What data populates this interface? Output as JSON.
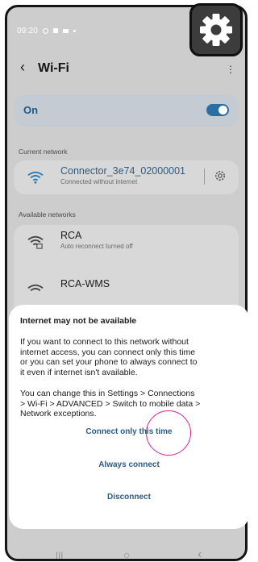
{
  "status_bar": {
    "time": "09:20",
    "icons": [
      "whatsapp-icon",
      "gallery-icon",
      "folder-icon",
      "dot-icon"
    ]
  },
  "header": {
    "title": "Wi-Fi",
    "back_icon": "back-chevron-icon",
    "more_icon": "more-vert-icon"
  },
  "wifi_toggle": {
    "label": "On",
    "state": "on",
    "accent": "#2a6fa3"
  },
  "current": {
    "section_label": "Current network",
    "name": "Connector_3e74_02000001",
    "status": "Connected without internet",
    "name_color": "#2d5b82"
  },
  "available": {
    "section_label": "Available networks",
    "networks": [
      {
        "name": "RCA",
        "status": "Auto reconnect turned off"
      },
      {
        "name": "RCA-WMS",
        "status": ""
      }
    ]
  },
  "dialog": {
    "title": "Internet may not be available",
    "body_1": [
      "If you want to connect to this network without",
      "internet access, you can connect only this time",
      "or you can set your phone to always connect to",
      "it even if internet isn't available."
    ],
    "body_2": [
      "You can change this in Settings > Connections",
      "> Wi-Fi > ADVANCED > Switch to mobile data >",
      "Network exceptions."
    ],
    "buttons": {
      "connect_once": "Connect only this time",
      "always": "Always connect",
      "disconnect": "Disconnect"
    },
    "highlight_color": "#d6219b"
  },
  "nav_bar": {
    "recents": "|||",
    "home": "○",
    "back": "‹"
  },
  "overlay_badge": {
    "icon": "gear-icon"
  }
}
